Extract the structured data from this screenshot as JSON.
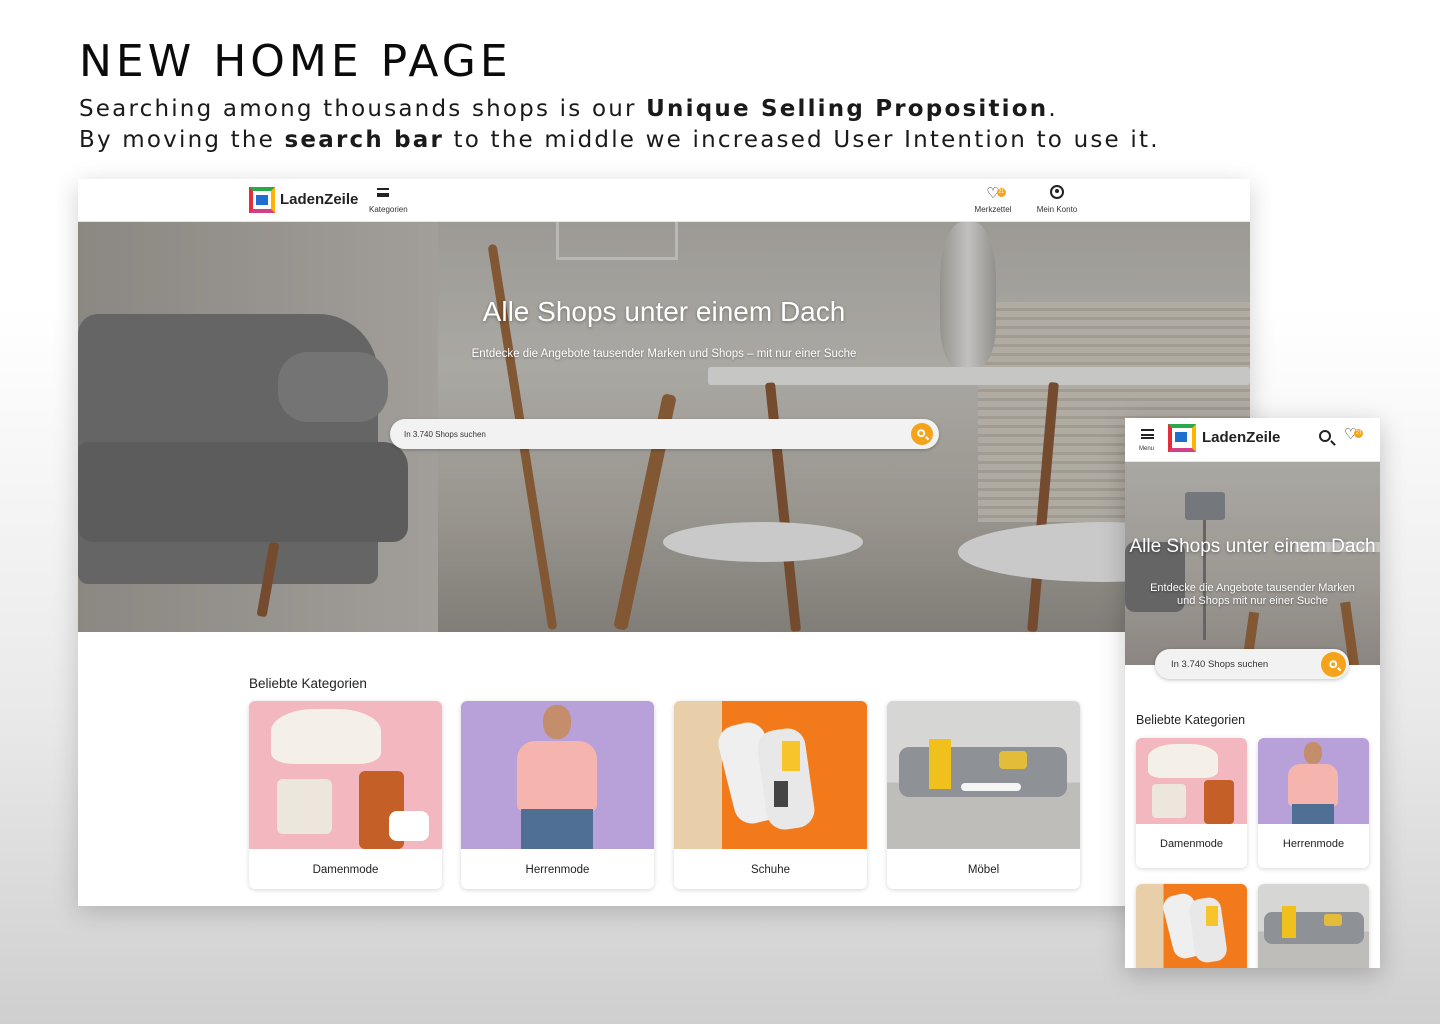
{
  "slide": {
    "headline": "NEW HOME PAGE",
    "line1_a": "Searching among thousands shops is our ",
    "line1_b": "Unique Selling Proposition",
    "line1_c": ".",
    "line2_a": "By moving the ",
    "line2_b": "search bar",
    "line2_c": " to the middle we increased User Intention to use it."
  },
  "desktop": {
    "logo_text": "LadenZeile",
    "menu_label": "Kategorien",
    "wishlist_label": "Merkzettel",
    "wishlist_count": "21",
    "account_label": "Mein Konto",
    "hero_title": "Alle Shops unter einem Dach",
    "hero_subtitle": "Entdecke die Angebote tausender Marken und Shops – mit nur einer Suche",
    "search_placeholder": "In 3.740 Shops suchen",
    "categories_title": "Beliebte Kategorien",
    "categories": [
      {
        "label": "Damenmode"
      },
      {
        "label": "Herrenmode"
      },
      {
        "label": "Schuhe"
      },
      {
        "label": "Möbel"
      }
    ]
  },
  "mobile": {
    "menu_label": "Menu",
    "logo_text": "LadenZeile",
    "wishlist_count": "21",
    "hero_title": "Alle Shops unter einem Dach",
    "hero_subtitle": "Entdecke die Angebote tausender Marken und Shops mit nur einer Suche",
    "search_placeholder": "In 3.740 Shops suchen",
    "categories_title": "Beliebte Kategorien",
    "categories": [
      {
        "label": "Damenmode"
      },
      {
        "label": "Herrenmode"
      }
    ]
  },
  "colors": {
    "accent": "#f5a31a",
    "text": "#222222"
  },
  "icons": {
    "menu": "hamburger-icon",
    "wishlist": "heart-icon",
    "account": "user-circle-icon",
    "search": "search-icon"
  }
}
